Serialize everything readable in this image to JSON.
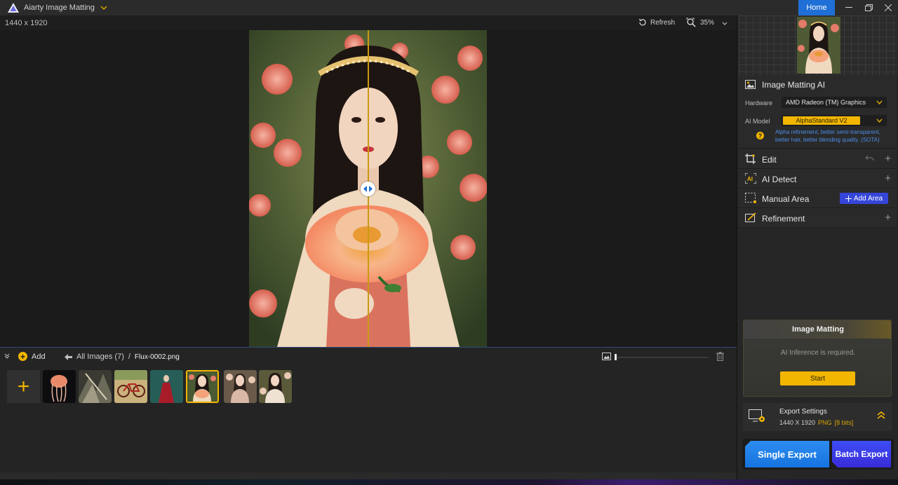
{
  "titlebar": {
    "app_title": "Aiarty Image Matting",
    "home_label": "Home"
  },
  "toolbar": {
    "dimensions": "1440 x 1920",
    "refresh_label": "Refresh",
    "zoom_level": "35%"
  },
  "strip": {
    "add_label": "Add",
    "all_images_label": "All Images (7)",
    "separator": "/",
    "current_file": "Flux-0002.png",
    "thumbnails": [
      {
        "icon": "jellyfish-thumbnail"
      },
      {
        "icon": "forest-thumbnail"
      },
      {
        "icon": "bicycle-thumbnail"
      },
      {
        "icon": "woman-red-dress-thumbnail"
      },
      {
        "icon": "girl-flower-thumbnail",
        "selected": true
      },
      {
        "icon": "woman-garden-thumbnail"
      },
      {
        "icon": "woman-portrait-thumbnail"
      }
    ]
  },
  "panel": {
    "image_matting_ai": {
      "title": "Image Matting AI",
      "hardware_label": "Hardware",
      "hardware_value": "AMD Radeon (TM) Graphics",
      "model_label": "AI Model",
      "model_value": "AlphaStandard  V2",
      "model_description": "Alpha refinement, better semi-transparent, better hair, better blending quality. (SOTA)"
    },
    "sections": {
      "edit": "Edit",
      "ai_detect": "AI Detect",
      "manual_area": "Manual Area",
      "add_area": "Add Area",
      "refinement": "Refinement"
    },
    "matting_card": {
      "title": "Image Matting",
      "message": "AI Inference is required.",
      "start_label": "Start"
    },
    "export_settings": {
      "title": "Export Settings",
      "size": "1440 X 1920",
      "format": "PNG",
      "bits": "[8 bits]"
    },
    "single_export": "Single Export",
    "batch_export": "Batch Export"
  },
  "colors": {
    "accent_yellow": "#f2b600",
    "home_blue": "#1f6fd6",
    "add_area_blue": "#3546d9"
  }
}
